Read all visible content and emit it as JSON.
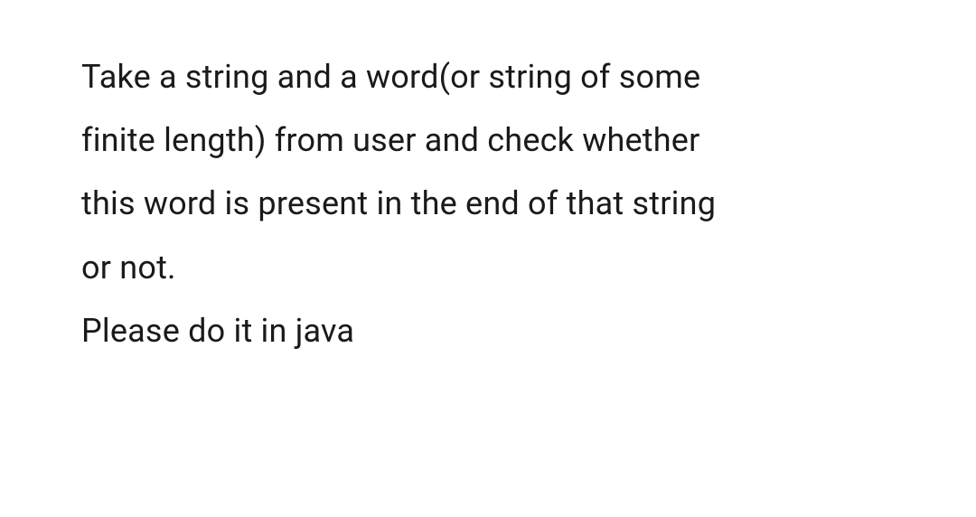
{
  "text": {
    "line1": "Take a string and a word(or string of some",
    "line2": "finite length) from user and check whether",
    "line3": "this word is  present in the end of that string",
    "line4": "or not.",
    "line5": "Please do it in java"
  }
}
